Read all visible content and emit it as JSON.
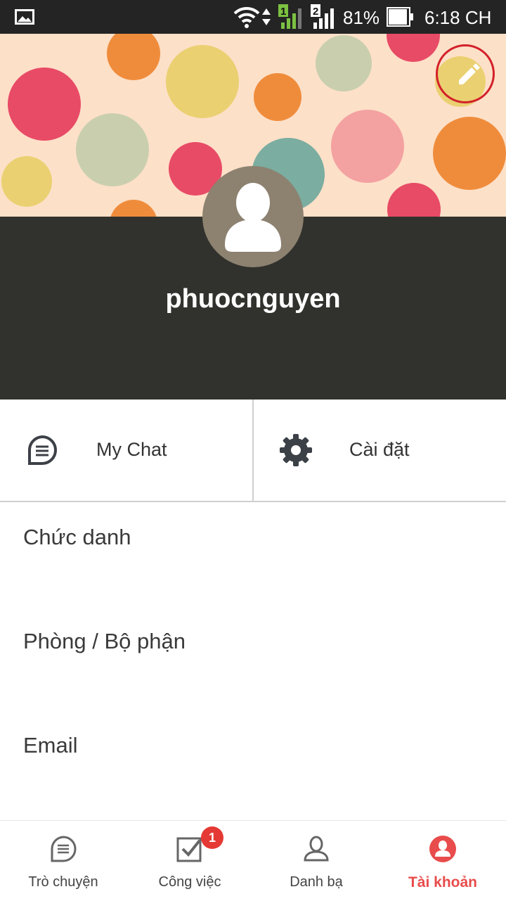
{
  "status_bar": {
    "battery_percent": "81%",
    "time": "6:18 CH",
    "sim1_label": "1",
    "sim2_label": "2",
    "icons": [
      "gallery-icon",
      "wifi-icon",
      "data-arrows-icon",
      "signal-sim1-icon",
      "signal-sim2-icon",
      "battery-icon"
    ]
  },
  "profile": {
    "username": "phuocnguyen",
    "edit_icon": "pencil-icon",
    "avatar_icon": "default-avatar-icon"
  },
  "actions": {
    "my_chat_label": "My Chat",
    "settings_label": "Cài đặt"
  },
  "fields": {
    "title_label": "Chức danh",
    "department_label": "Phòng / Bộ phận",
    "email_label": "Email"
  },
  "bottom_nav": {
    "items": [
      {
        "label": "Trò chuyện",
        "icon": "chat-icon"
      },
      {
        "label": "Công việc",
        "icon": "task-check-icon",
        "badge": "1"
      },
      {
        "label": "Danh bạ",
        "icon": "contacts-icon"
      },
      {
        "label": "Tài khoản",
        "icon": "account-icon",
        "active": true
      }
    ]
  },
  "colors": {
    "accent": "#e84c4c",
    "header_dark": "#31322d",
    "cover_bg": "#fde0c8",
    "badge": "#e53935",
    "edit_highlight": "#d3202a"
  }
}
